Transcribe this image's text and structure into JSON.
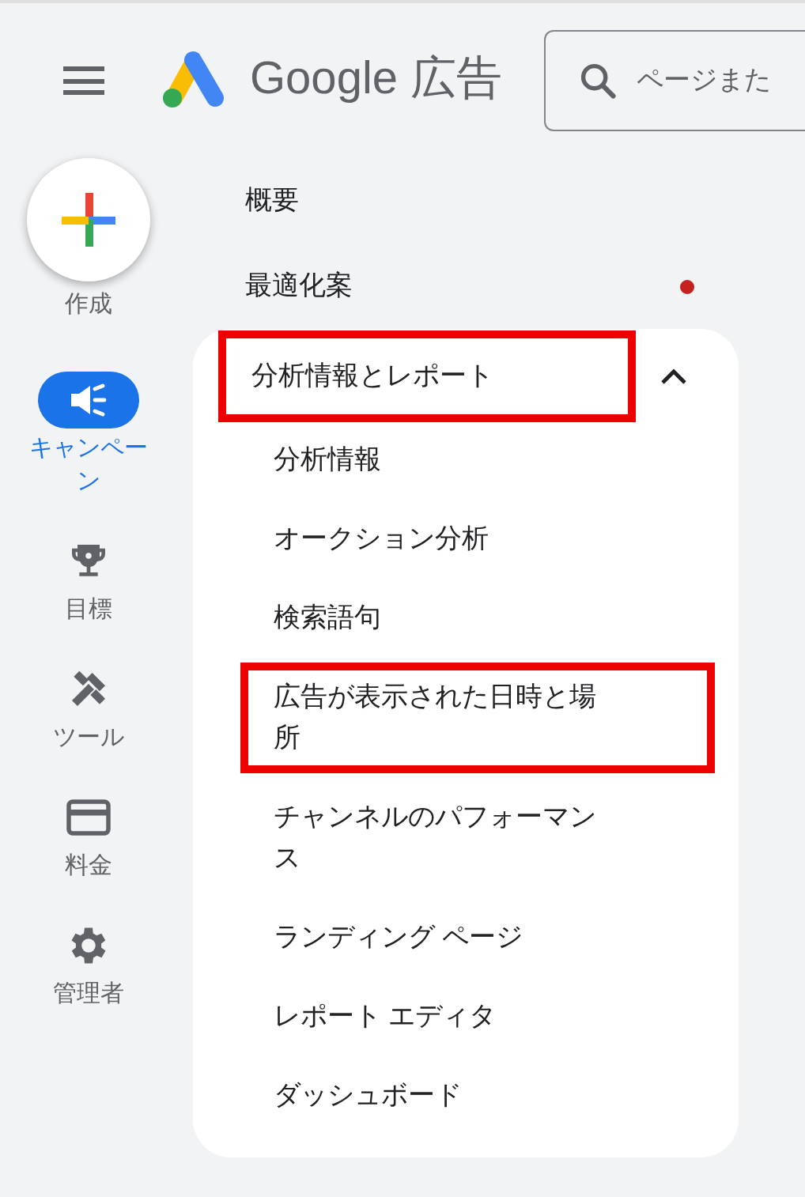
{
  "header": {
    "logo_text": "Google",
    "logo_suffix": "広告",
    "search": {
      "placeholder": "ページまた"
    }
  },
  "rail": [
    {
      "kind": "create",
      "label": "作成",
      "selected": false
    },
    {
      "kind": "campaign",
      "label": "キャンペーン",
      "selected": true
    },
    {
      "kind": "goals",
      "label": "目標",
      "selected": false
    },
    {
      "kind": "tools",
      "label": "ツール",
      "selected": false
    },
    {
      "kind": "billing",
      "label": "料金",
      "selected": false
    },
    {
      "kind": "admin",
      "label": "管理者",
      "selected": false
    }
  ],
  "nav": [
    {
      "label": "概要",
      "alert": false
    },
    {
      "label": "最適化案",
      "alert": true
    }
  ],
  "section": {
    "label": "分析情報とレポート",
    "expanded": true,
    "highlighted": true,
    "children": [
      {
        "label": "分析情報",
        "highlighted": false
      },
      {
        "label": "オークション分析",
        "highlighted": false
      },
      {
        "label": "検索語句",
        "highlighted": false
      },
      {
        "label": "広告が表示された日時と場所",
        "highlighted": true
      },
      {
        "label": "チャンネルのパフォーマンス",
        "highlighted": false
      },
      {
        "label": "ランディング ページ",
        "highlighted": false
      },
      {
        "label": "レポート エディタ",
        "highlighted": false
      },
      {
        "label": "ダッシュボード",
        "highlighted": false
      }
    ]
  }
}
